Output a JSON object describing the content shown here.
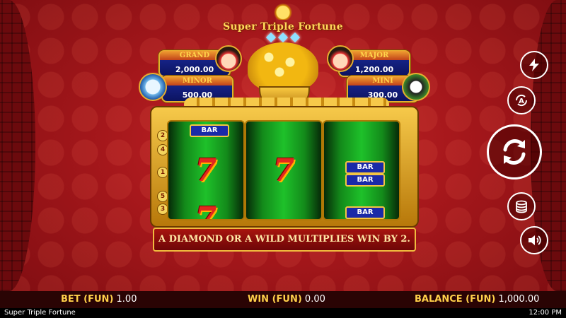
{
  "game": {
    "title": "Super Triple Fortune"
  },
  "jackpots": {
    "grand": {
      "label": "GRAND",
      "amount": "2,000.00"
    },
    "major": {
      "label": "MAJOR",
      "amount": "1,200.00"
    },
    "minor": {
      "label": "MINOR",
      "amount": "500.00"
    },
    "mini": {
      "label": "MINI",
      "amount": "300.00"
    }
  },
  "reels": {
    "reel1": {
      "top": "BAR",
      "middle": "7",
      "bottom": "7"
    },
    "reel2": {
      "middle": "7"
    },
    "reel3": {
      "top": "BAR",
      "middle_top": "BAR",
      "bottom": "BAR"
    }
  },
  "paylines_left": [
    "2",
    "4",
    "1",
    "5",
    "3"
  ],
  "info_message": "A DIAMOND OR A WILD MULTIPLIES WIN BY 2.",
  "bottom_bar": {
    "bet_label": "BET (FUN)",
    "bet_value": "1.00",
    "win_label": "WIN (FUN)",
    "win_value": "0.00",
    "balance_label": "BALANCE (FUN)",
    "balance_value": "1,000.00"
  },
  "status_bar": {
    "app_title": "Super Triple Fortune",
    "time": "12:00 PM"
  },
  "icons": {
    "turbo": "lightning-icon",
    "auto": "autoplay-icon",
    "spin": "spin-icon",
    "bet": "coin-stack-icon",
    "sound": "speaker-icon"
  }
}
